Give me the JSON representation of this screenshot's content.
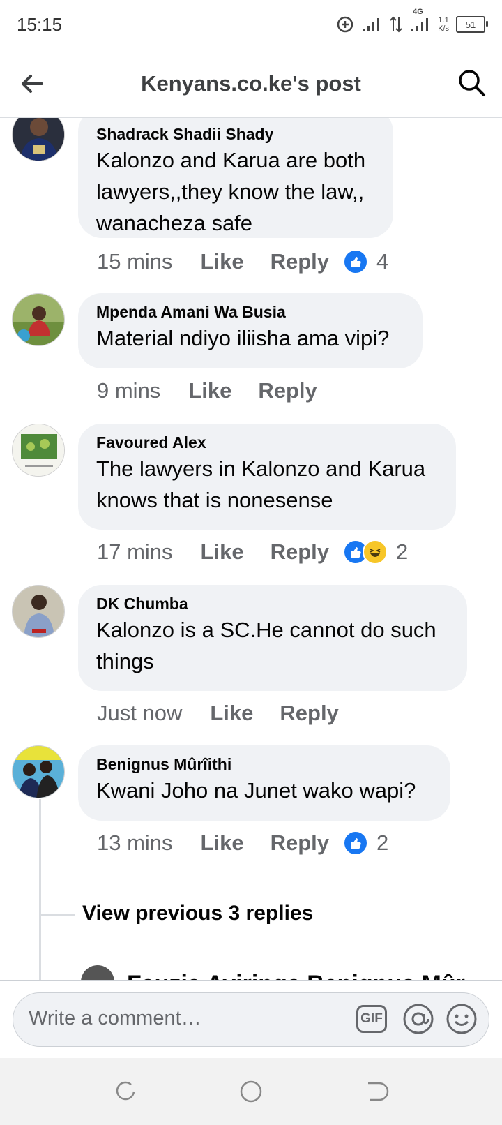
{
  "status_bar": {
    "time": "15:15",
    "network": "4G",
    "speed_value": "1.1",
    "speed_unit": "K/s",
    "battery": "51"
  },
  "header": {
    "title": "Kenyans.co.ke's post"
  },
  "comments": [
    {
      "author": "Shadrack Shadii Shady",
      "text": "Kalonzo and Karua are both lawyers,,they know the law,, wanacheza safe",
      "time": "15 mins",
      "like": "Like",
      "reply": "Reply",
      "reaction_count": "4"
    },
    {
      "author": "Mpenda Amani Wa Busia",
      "text": "Material ndiyo iliisha ama vipi?",
      "time": "9 mins",
      "like": "Like",
      "reply": "Reply"
    },
    {
      "author": "Favoured Alex",
      "text": "The lawyers in Kalonzo and Karua knows that is nonesense",
      "time": "17 mins",
      "like": "Like",
      "reply": "Reply",
      "reaction_count": "2"
    },
    {
      "author": "DK Chumba",
      "text": "Kalonzo is a SC.He cannot do such things",
      "time": "Just now",
      "like": "Like",
      "reply": "Reply"
    },
    {
      "author": "Benignus Mûrîithi",
      "text": "Kwani Joho na Junet wako wapi?",
      "time": "13 mins",
      "like": "Like",
      "reply": "Reply",
      "reaction_count": "2"
    }
  ],
  "view_previous": "View previous 3 replies",
  "next_reply_author": "Fauzia Ayiringa  Benignus Mûr",
  "composer": {
    "placeholder": "Write a comment…",
    "gif_label": "GIF"
  },
  "colors": {
    "accent": "#1877f2",
    "bubble": "#f0f2f5",
    "secondary_text": "#65676b"
  },
  "icons": [
    "back-arrow-icon",
    "search-icon",
    "gif-icon",
    "mention-icon",
    "emoji-icon",
    "like-reaction-icon",
    "haha-reaction-icon"
  ]
}
